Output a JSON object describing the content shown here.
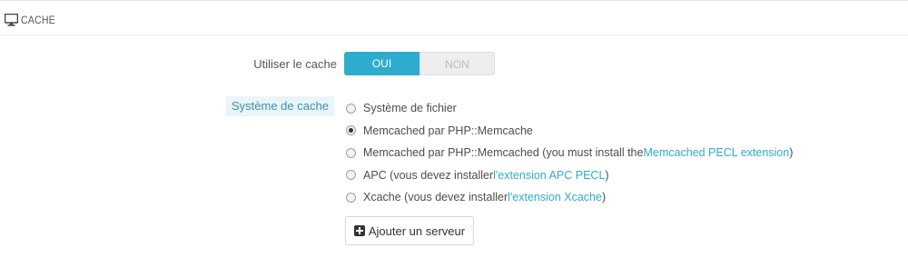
{
  "panel": {
    "title": "CACHE",
    "icon": "desktop-icon"
  },
  "use_cache": {
    "label": "Utiliser le cache",
    "yes_label": "OUI",
    "no_label": "NON",
    "selected": "OUI"
  },
  "cache_system": {
    "label": "Système de cache",
    "options": [
      {
        "text": "Système de fichier",
        "link": "",
        "suffix": "",
        "checked": false
      },
      {
        "text": "Memcached par PHP::Memcache",
        "link": "",
        "suffix": "",
        "checked": true
      },
      {
        "text": "Memcached par PHP::Memcached (you must install the ",
        "link": "Memcached PECL extension",
        "suffix": ")",
        "checked": false
      },
      {
        "text": "APC (vous devez installer ",
        "link": "l'extension APC PECL",
        "suffix": ")",
        "checked": false
      },
      {
        "text": "Xcache (vous devez installer ",
        "link": "l'extension Xcache",
        "suffix": ")",
        "checked": false
      }
    ]
  },
  "add_server_button": "Ajouter un serveur",
  "colors": {
    "accent": "#2eacce",
    "label_bg": "#eaf5f9"
  }
}
